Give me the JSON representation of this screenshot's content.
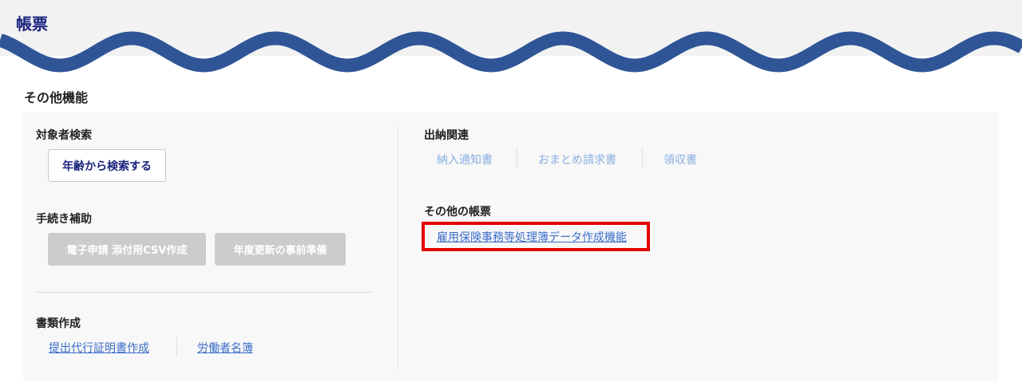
{
  "header": {
    "title": "帳票"
  },
  "section": {
    "title": "その他機能"
  },
  "target_search": {
    "label": "対象者検索",
    "button": "年齢から検索する"
  },
  "procedure_assist": {
    "label": "手続き補助",
    "buttons": [
      "電子申請 添付用CSV作成",
      "年度更新の事前準備"
    ]
  },
  "document_creation": {
    "label": "書類作成",
    "links": [
      "提出代行証明書作成",
      "労働者名簿"
    ]
  },
  "payment": {
    "label": "出納関連",
    "links": [
      "納入通知書",
      "おまとめ請求書",
      "領収書"
    ]
  },
  "other_forms": {
    "label": "その他の帳票",
    "link": "雇用保険事務等処理簿データ作成機能"
  },
  "colors": {
    "title": "#1a237e",
    "wave": "#2f5597",
    "link": "#3a6cc9",
    "disabled_link": "#8aaee0",
    "highlight": "#e60000",
    "disabled_button": "#cccccc"
  }
}
